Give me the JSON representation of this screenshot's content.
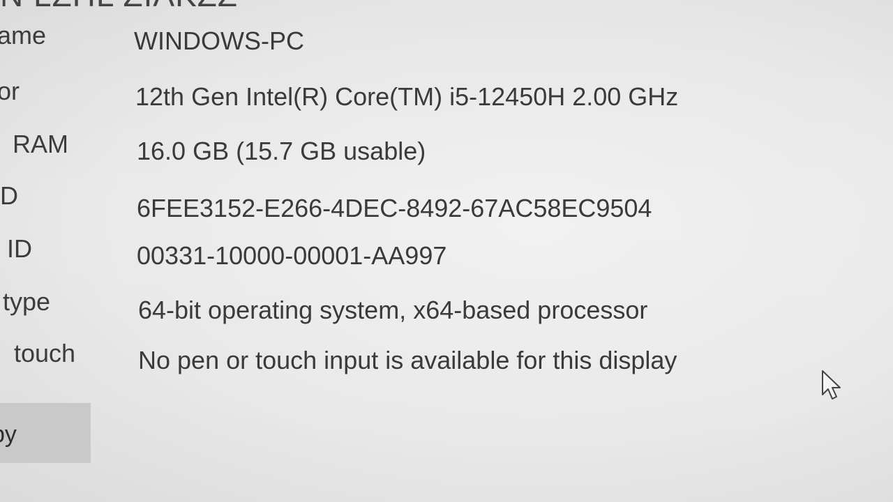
{
  "window": {
    "heading_fragment": "N  LZHL  ZIAKZZ"
  },
  "specs": [
    {
      "key": "device_name",
      "label": "ame",
      "value": "WINDOWS-PC"
    },
    {
      "key": "processor",
      "label": "or",
      "value": "12th Gen Intel(R) Core(TM) i5-12450H   2.00 GHz"
    },
    {
      "key": "installed_ram",
      "label": "RAM",
      "value": "16.0 GB (15.7 GB usable)"
    },
    {
      "key": "device_id",
      "label": "D",
      "value": "6FEE3152-E266-4DEC-8492-67AC58EC9504"
    },
    {
      "key": "product_id",
      "label": "ID",
      "value": "00331-10000-00001-AA997"
    },
    {
      "key": "system_type",
      "label": "type",
      "value": "64-bit operating system, x64-based processor"
    },
    {
      "key": "pen_touch",
      "label": "touch",
      "value": "No pen or touch input is available for this display"
    }
  ],
  "actions": {
    "copy_label": "py"
  },
  "icons": {
    "cursor": "mouse-pointer-icon"
  }
}
